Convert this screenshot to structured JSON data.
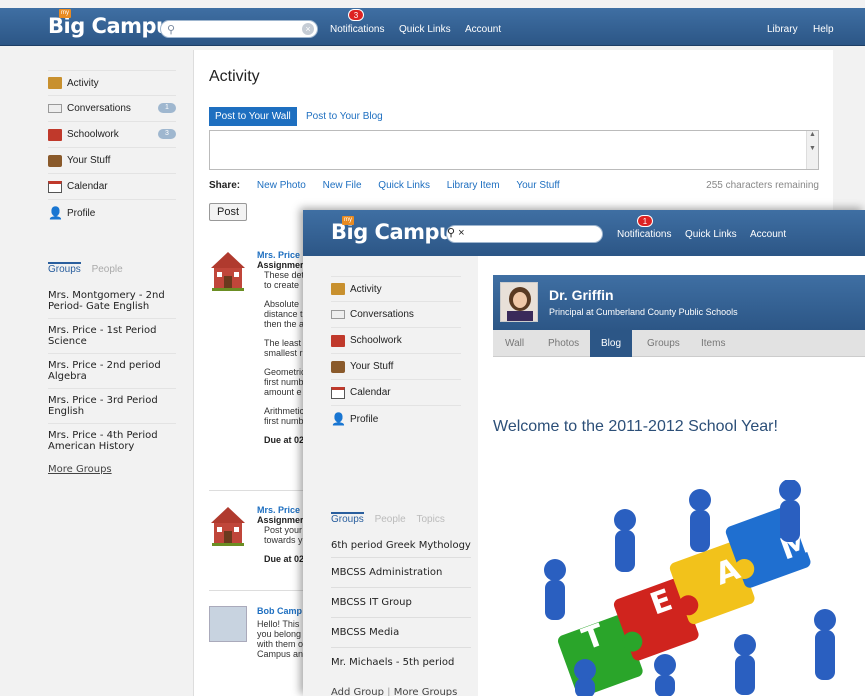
{
  "app": {
    "logo_my": "my",
    "logo_text": "Big Campus"
  },
  "header": {
    "notifications_label": "Notifications",
    "notifications_count": "3",
    "quick_links_label": "Quick Links",
    "account_label": "Account",
    "library_label": "Library",
    "help_label": "Help"
  },
  "sidebar": {
    "items": [
      {
        "label": "Activity",
        "icon": "activity-icon"
      },
      {
        "label": "Conversations",
        "icon": "envelope-icon",
        "badge": "1"
      },
      {
        "label": "Schoolwork",
        "icon": "schoolwork-icon",
        "badge": "3"
      },
      {
        "label": "Your Stuff",
        "icon": "briefcase-icon"
      },
      {
        "label": "Calendar",
        "icon": "calendar-icon"
      },
      {
        "label": "Profile",
        "icon": "person-icon"
      }
    ],
    "groups_tab": "Groups",
    "people_tab": "People",
    "groups": [
      "Mrs. Montgomery - 2nd Period- Gate English",
      "Mrs. Price - 1st Period Science",
      "Mrs. Price - 2nd period Algebra",
      "Mrs. Price - 3rd Period English",
      "Mrs. Price - 4th Period American History"
    ],
    "more_groups": "More Groups"
  },
  "main": {
    "title": "Activity",
    "tab_wall": "Post to Your Wall",
    "tab_blog": "Post to Your Blog",
    "share_label": "Share:",
    "share_links": [
      "New Photo",
      "New File",
      "Quick Links",
      "Library Item",
      "Your Stuff"
    ],
    "chars_remaining": "255 characters remaining",
    "post_button": "Post",
    "feed": [
      {
        "title": "Mrs. Price",
        "subtitle": "Assignmer",
        "lines": [
          "These det",
          "to create"
        ],
        "paras": [
          [
            "Absolute",
            "distance t",
            "then the a"
          ],
          [
            "The least",
            "smallest r"
          ],
          [
            "Geometric",
            "first numb",
            "amount e"
          ],
          [
            "Arithmetic",
            "first numb"
          ]
        ],
        "due": "Due at 02"
      },
      {
        "title": "Mrs. Price",
        "subtitle": "Assignmer",
        "lines": [
          "Post your",
          "towards y"
        ],
        "due": "Due at 02"
      },
      {
        "title": "Bob Camp",
        "lines": [
          "Hello! This",
          "you belong",
          "with them o",
          "Campus an"
        ]
      }
    ]
  },
  "front": {
    "notifications_count": "1",
    "sidebar_items": [
      {
        "label": "Activity",
        "icon": "activity-icon"
      },
      {
        "label": "Conversations",
        "icon": "envelope-icon"
      },
      {
        "label": "Schoolwork",
        "icon": "schoolwork-icon"
      },
      {
        "label": "Your Stuff",
        "icon": "briefcase-icon"
      },
      {
        "label": "Calendar",
        "icon": "calendar-icon"
      },
      {
        "label": "Profile",
        "icon": "person-icon"
      }
    ],
    "groups_tab": "Groups",
    "people_tab": "People",
    "topics_tab": "Topics",
    "groups": [
      "6th period Greek Mythology",
      "MBCSS Administration",
      "MBCSS IT Group",
      "MBCSS Media",
      "Mr. Michaels - 5th period"
    ],
    "add_group": "Add Group",
    "separator": "|",
    "more_groups": "More Groups",
    "profile": {
      "name": "Dr. Griffin",
      "role": "Principal at Cumberland County Public Schools"
    },
    "profile_tabs": [
      "Wall",
      "Photos",
      "Blog",
      "Groups",
      "Items"
    ],
    "active_tab": "Blog",
    "blog_title": "Welcome to the 2011-2012 School Year!",
    "team_letters": [
      "T",
      "E",
      "A",
      "M"
    ]
  },
  "colors": {
    "header": "#2c5686",
    "accent": "#1e6fc0",
    "badge": "#d22222"
  }
}
